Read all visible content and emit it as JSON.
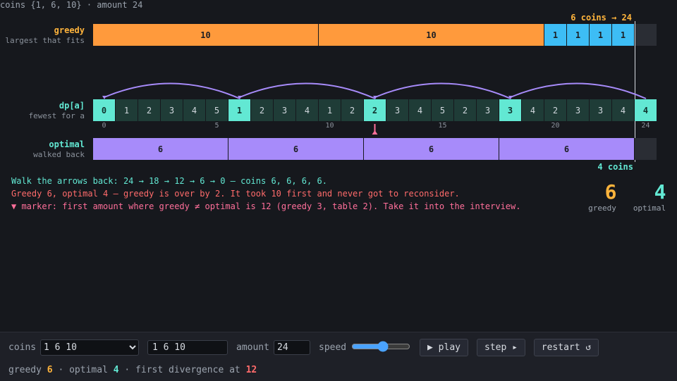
{
  "header": "coins {1, 6, 10} · amount 24",
  "greedy": {
    "label": "greedy",
    "sub": "largest that fits",
    "summary": "6 coins → 24",
    "segments": [
      10,
      10,
      1,
      1,
      1,
      1
    ],
    "colors": {
      "10": "#ff9a3c",
      "1": "#3dbdf5"
    }
  },
  "dp": {
    "label": "dp[a]",
    "sub": "fewest for a",
    "values": [
      0,
      1,
      2,
      3,
      4,
      5,
      1,
      2,
      3,
      4,
      1,
      2,
      2,
      3,
      4,
      5,
      2,
      3,
      3,
      4,
      2,
      3,
      3,
      4,
      4
    ],
    "highlight": [
      0,
      6,
      12,
      18,
      24
    ],
    "ticks": [
      0,
      5,
      10,
      15,
      20,
      24
    ],
    "marker_index": 12
  },
  "optimal": {
    "label": "optimal",
    "sub": "walked back",
    "segments": [
      6,
      6,
      6,
      6
    ],
    "summary": "4 coins"
  },
  "messages": {
    "line1": "Walk the arrows back: 24 → 18 → 12 → 6 → 0 — coins 6, 6, 6, 6.",
    "line2": "Greedy 6, optimal 4 — greedy is over by 2. It took 10 first and never got to reconsider.",
    "line3": "▼ marker: first amount where greedy ≠ optimal is 12 (greedy 3, table 2). Take it into the interview."
  },
  "scores": {
    "greedy_value": "6",
    "greedy_label": "greedy",
    "optimal_value": "4",
    "optimal_label": "optimal"
  },
  "controls": {
    "coins_label": "coins",
    "coins_select": "1 6 10",
    "coins_input": "1 6 10",
    "amount_label": "amount",
    "amount_value": "24",
    "speed_label": "speed",
    "speed_value": 55,
    "play": "▶ play",
    "step": "step ▸",
    "restart": "restart ↺"
  },
  "status": {
    "greedy_label": "greedy",
    "greedy_value": "6",
    "optimal_label": "optimal",
    "optimal_value": "4",
    "divergence_label": "first divergence at",
    "divergence_value": "12",
    "sep": "·"
  },
  "colors": {
    "greedy": "#ffb43c",
    "optimal": "#62e8d3",
    "purple": "#a78bfa",
    "warn": "#ff6b6b",
    "pink": "#ff6f9a",
    "cell_hi": "#62e8d3",
    "cell": "#1f3c37"
  }
}
